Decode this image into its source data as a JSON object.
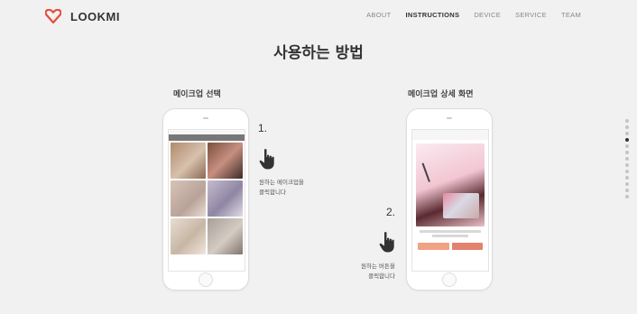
{
  "header": {
    "logo_text": "LOOKMI",
    "brand_color": "#e74c3c",
    "nav": [
      {
        "label": "ABOUT",
        "active": false
      },
      {
        "label": "INSTRUCTIONS",
        "active": true
      },
      {
        "label": "DEVICE",
        "active": false
      },
      {
        "label": "SERVICE",
        "active": false
      },
      {
        "label": "TEAM",
        "active": false
      }
    ]
  },
  "main": {
    "title": "사용하는 방법",
    "left": {
      "subtitle": "메이크업 선택",
      "step_number": "1.",
      "caption_line1": "원하는 메이크업을",
      "caption_line2": "클릭합니다"
    },
    "right": {
      "subtitle": "메이크업 상세 화면",
      "step_number": "2.",
      "caption_line1": "원하는 버튼을",
      "caption_line2": "클릭합니다"
    }
  },
  "pagination": {
    "count": 13,
    "active_index": 3,
    "icons": [
      "dot-indicator"
    ]
  },
  "icons": {
    "logo": "heart-logo-icon",
    "tap": "tap-hand-icon"
  }
}
